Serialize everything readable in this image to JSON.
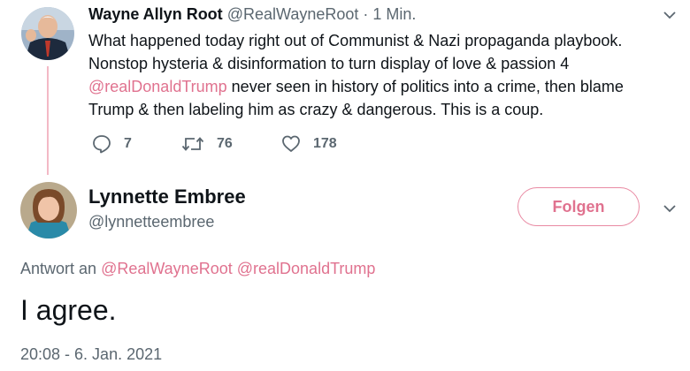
{
  "original_tweet": {
    "author_name": "Wayne Allyn Root",
    "author_handle": "@RealWayneRoot",
    "time": "· 1 Min.",
    "line1": "What happened today right out of Communist & Nazi propaganda playbook.",
    "line2": "Nonstop hysteria & disinformation to turn display of love & passion 4",
    "mention": "@realDonaldTrump",
    "line3_rest": " never seen in history of politics into a crime, then blame",
    "line4": "Trump & then labeling him as crazy & dangerous. This is a coup.",
    "replies": "7",
    "retweets": "76",
    "likes": "178"
  },
  "reply_tweet": {
    "author_name": "Lynnette Embree",
    "author_handle": "@lynnetteembree",
    "follow_label": "Folgen",
    "reply_prefix": "Antwort an",
    "reply_to_1": "@RealWayneRoot",
    "reply_to_2": "@realDonaldTrump",
    "text": "I agree.",
    "timestamp": "20:08 - 6. Jan. 2021"
  },
  "colors": {
    "accent": "#e0728f",
    "muted": "#5b6770",
    "thread_line": "#f3b9c6"
  },
  "icons": [
    "reply-icon",
    "retweet-icon",
    "like-icon",
    "chevron-down-icon"
  ]
}
